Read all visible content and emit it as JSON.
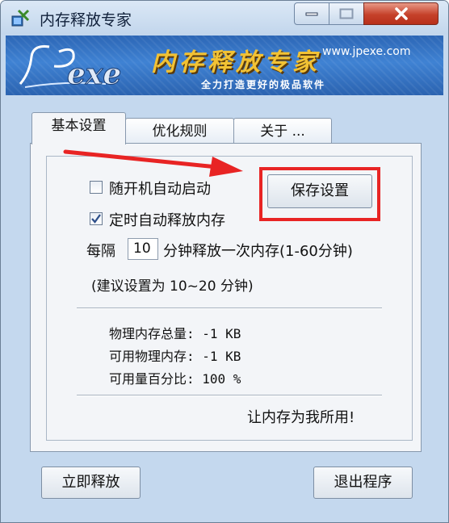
{
  "window": {
    "title": "内存释放专家"
  },
  "banner": {
    "title": "内存释放专家",
    "url": "www.jpexe.com",
    "slogan": "全力打造更好的极品软件"
  },
  "tabs": [
    {
      "label": "基本设置",
      "active": true
    },
    {
      "label": "优化规则",
      "active": false
    },
    {
      "label": "关于 ...",
      "active": false
    }
  ],
  "settings": {
    "autostart_label": "随开机自动启动",
    "autostart_checked": false,
    "timed_release_label": "定时自动释放内存",
    "timed_release_checked": true,
    "interval_prefix": "每隔",
    "interval_value": "10",
    "interval_suffix": "分钟释放一次内存(1-60分钟)",
    "suggestion": "(建议设置为 10~20 分钟)",
    "save_button": "保存设置"
  },
  "memory": {
    "physical_total": "物理内存总量: -1 KB",
    "physical_available": "可用物理内存: -1 KB",
    "available_percent": "可用量百分比: 100 %"
  },
  "slogan_bottom": "让内存为我所用!",
  "buttons": {
    "release_now": "立即释放",
    "exit": "退出程序"
  },
  "colors": {
    "annotation_red": "#e82424",
    "banner_blue": "#3f82d3",
    "banner_gold": "#f2c234"
  }
}
